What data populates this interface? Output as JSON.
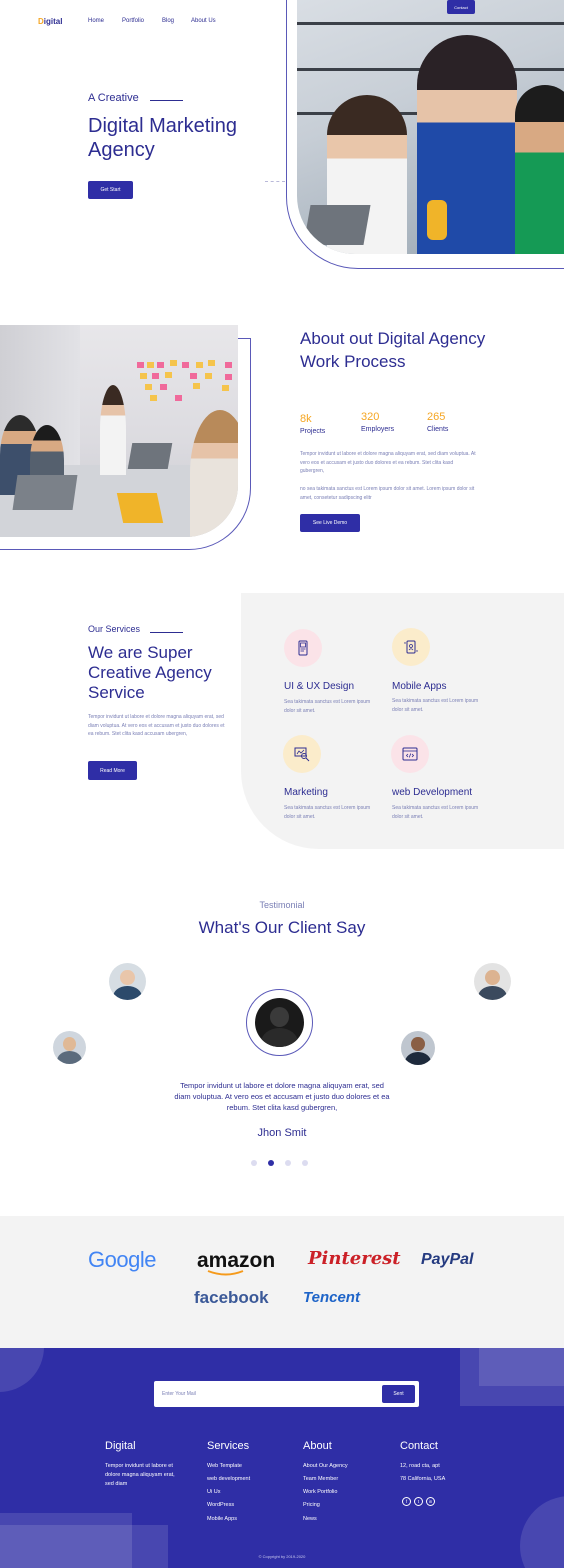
{
  "nav": {
    "logo_first": "D",
    "logo_rest": "igital",
    "links": [
      "Home",
      "Portfolio",
      "Blog",
      "About Us"
    ],
    "contact": "Contact"
  },
  "hero": {
    "subtitle": "A Creative",
    "title": "Digital Marketing Agency",
    "button": "Get Start"
  },
  "about": {
    "title": "About out Digital Agency Work Process",
    "stats": [
      {
        "value": "8k",
        "label": "Projects"
      },
      {
        "value": "320",
        "label": "Employers"
      },
      {
        "value": "265",
        "label": "Clients"
      }
    ],
    "paragraph1": "Tempor invidunt ut labore et dolore magna aliquyam erat, sed diam voluptua. At vero eos et accusam et justo duo dolores et ea rebum. Stet clita kasd gubergren,",
    "paragraph2": "no sea takimata sanctus est Lorem ipsum dolor sit amet. Lorem ipsum dolor sit amet, consetetur sadipscing elitr",
    "button": "See Live Demo"
  },
  "services": {
    "subtitle": "Our Services",
    "title": "We are Super Creative Agency Service",
    "paragraph": "Tempor invidunt ut labore et dolore magna aliquyam erat, sed diam voluptua. At vero eos et accusam et justo duo dolores et ea rebum. Stet clita kasd accusam ubergren,",
    "button": "Read More",
    "items": [
      {
        "name": "UI & UX Design",
        "desc": "Sea takimata sanctus est Lorem ipsum dolor sit amet.",
        "icon": "mobile-ui-icon"
      },
      {
        "name": "Mobile Apps",
        "desc": "Sea takimata sanctus est Lorem ipsum dolor sit amet.",
        "icon": "mobile-app-icon"
      },
      {
        "name": "Marketing",
        "desc": "Sea takimata sanctus est Lorem ipsum dolor sit amet.",
        "icon": "analytics-icon"
      },
      {
        "name": "web Development",
        "desc": "Sea takimata sanctus est Lorem ipsum dolor sit amet.",
        "icon": "code-window-icon"
      }
    ]
  },
  "testimonial": {
    "subtitle": "Testimonial",
    "title": "What's Our Client Say",
    "quote": "Tempor invidunt ut labore et dolore magna aliquyam erat, sed diam voluptua. At vero eos et accusam et justo duo dolores et ea rebum. Stet clita kasd gubergren,",
    "name": "Jhon Smit",
    "active_dot": 2
  },
  "brands": [
    "Google",
    "amazon",
    "Pinterest",
    "PayPal",
    "facebook",
    "Tencent"
  ],
  "footer": {
    "email_placeholder": "Enter Your Mail",
    "send": "Sent",
    "digital_head": "Digital",
    "digital_text": "Tempor invidunt ut labore et dolore magna aliquyam erat, sed diam",
    "services_head": "Services",
    "services_links": [
      "Web Template",
      "web development",
      "Ui Ux",
      "WordPress",
      "Mobile Apps"
    ],
    "about_head": "About",
    "about_links": [
      "About Our Agency",
      "Team Member",
      "Work Portfolio",
      "Pricing",
      "News"
    ],
    "contact_head": "Contact",
    "contact_lines": [
      "12, road cta, apt",
      "78 California, USA"
    ],
    "social": [
      "f",
      "t",
      "in"
    ],
    "copyright": "© Copyright by 2019-2020"
  },
  "colors": {
    "primary": "#2f2ea6",
    "accent": "#f5a623",
    "text": "#2d2d91",
    "muted": "#7a7fb5",
    "light_bg": "#f3f3f3"
  }
}
